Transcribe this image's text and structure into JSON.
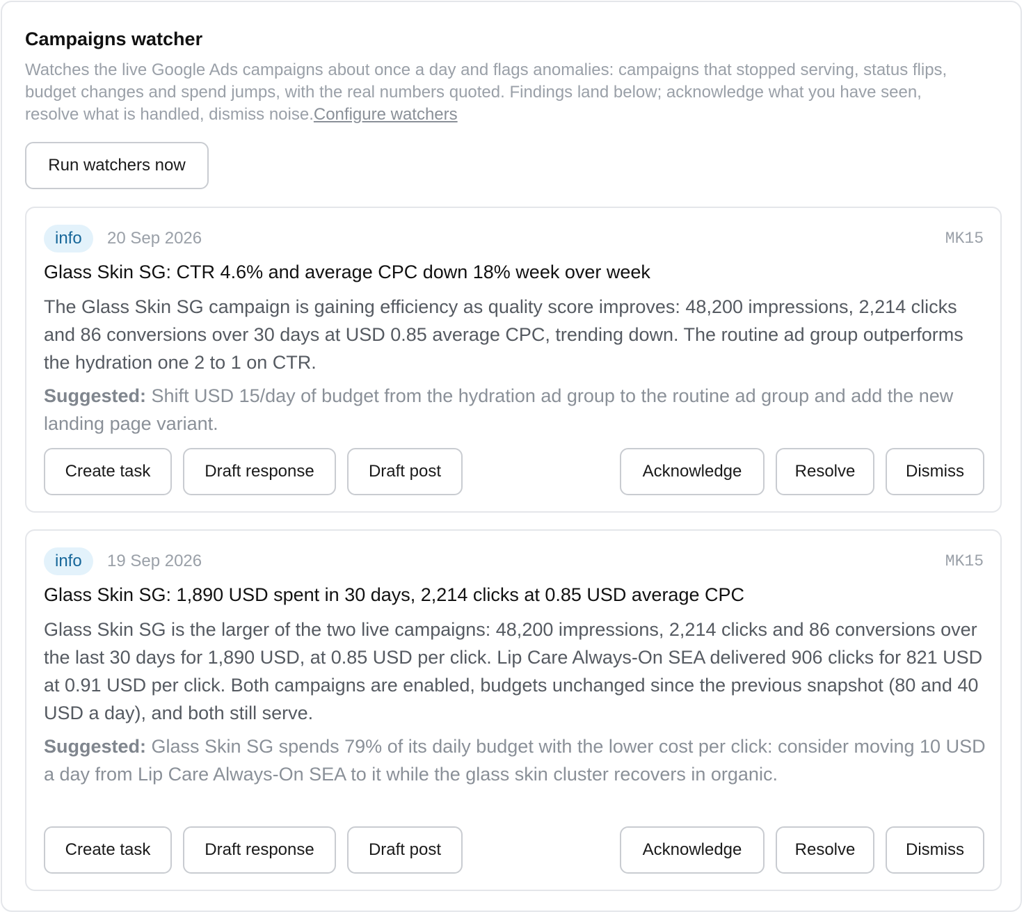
{
  "panel": {
    "title": "Campaigns watcher",
    "description": "Watches the live Google Ads campaigns about once a day and flags anomalies: campaigns that stopped serving, status flips, budget changes and spend jumps, with the real numbers quoted. Findings land below; acknowledge what you have seen, resolve what is handled, dismiss noise.",
    "configure_link": "Configure watchers",
    "run_button": "Run watchers now"
  },
  "colors": {
    "badge_bg": "#e3f2fb",
    "badge_text": "#17679a",
    "muted_text": "#9aa0a8",
    "border": "#e4e6ea"
  },
  "findings": [
    {
      "severity": "info",
      "date": "20 Sep 2026",
      "code": "MK15",
      "title": "Glass Skin SG: CTR 4.6% and average CPC down 18% week over week",
      "body": "The Glass Skin SG campaign is gaining efficiency as quality score improves: 48,200 impressions, 2,214 clicks and 86 conversions over 30 days at USD 0.85 average CPC, trending down. The routine ad group outperforms the hydration one 2 to 1 on CTR.",
      "suggested_label": "Suggested:",
      "suggested_text": "Shift USD 15/day of budget from the hydration ad group to the routine ad group and add the new landing page variant.",
      "actions": {
        "create_task": "Create task",
        "draft_response": "Draft response",
        "draft_post": "Draft post",
        "acknowledge": "Acknowledge",
        "resolve": "Resolve",
        "dismiss": "Dismiss"
      }
    },
    {
      "severity": "info",
      "date": "19 Sep 2026",
      "code": "MK15",
      "title": "Glass Skin SG: 1,890 USD spent in 30 days, 2,214 clicks at 0.85 USD average CPC",
      "body": "Glass Skin SG is the larger of the two live campaigns: 48,200 impressions, 2,214 clicks and 86 conversions over the last 30 days for 1,890 USD, at 0.85 USD per click. Lip Care Always-On SEA delivered 906 clicks for 821 USD at 0.91 USD per click. Both campaigns are enabled, budgets unchanged since the previous snapshot (80 and 40 USD a day), and both still serve.",
      "suggested_label": "Suggested:",
      "suggested_text": "Glass Skin SG spends 79% of its daily budget with the lower cost per click: consider moving 10 USD a day from Lip Care Always-On SEA to it while the glass skin cluster recovers in organic.",
      "actions": {
        "create_task": "Create task",
        "draft_response": "Draft response",
        "draft_post": "Draft post",
        "acknowledge": "Acknowledge",
        "resolve": "Resolve",
        "dismiss": "Dismiss"
      }
    }
  ]
}
